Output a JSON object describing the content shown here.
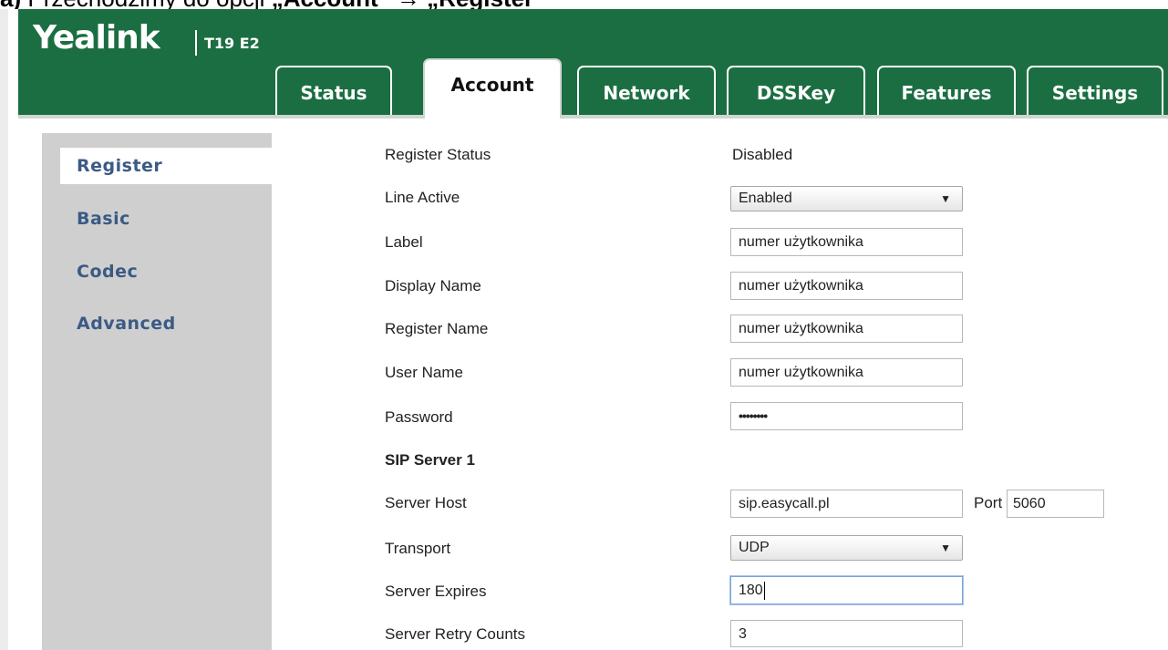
{
  "document_caption": {
    "prefix": "a)",
    "text": " Przechodzimy do opcji ",
    "item1": "„Account”",
    "joiner": " → ",
    "item2": "„Register”"
  },
  "app": {
    "brand": "Yealink",
    "model": "T19 E2"
  },
  "tabs": [
    {
      "label": "Status",
      "active": false
    },
    {
      "label": "Account",
      "active": true
    },
    {
      "label": "Network",
      "active": false
    },
    {
      "label": "DSSKey",
      "active": false
    },
    {
      "label": "Features",
      "active": false
    },
    {
      "label": "Settings",
      "active": false
    }
  ],
  "sidebar": {
    "items": [
      {
        "label": "Register",
        "active": true
      },
      {
        "label": "Basic",
        "active": false
      },
      {
        "label": "Codec",
        "active": false
      },
      {
        "label": "Advanced",
        "active": false
      }
    ]
  },
  "form": {
    "register_status": {
      "label": "Register Status",
      "value": "Disabled"
    },
    "line_active": {
      "label": "Line Active",
      "value": "Enabled"
    },
    "label": {
      "label": "Label",
      "value": "numer użytkownika"
    },
    "display_name": {
      "label": "Display Name",
      "value": "numer użytkownika"
    },
    "register_name": {
      "label": "Register Name",
      "value": "numer użytkownika"
    },
    "user_name": {
      "label": "User Name",
      "value": "numer użytkownika"
    },
    "password": {
      "label": "Password",
      "value": "••••••••"
    },
    "sip_server_title": "SIP Server 1",
    "server_host": {
      "label": "Server Host",
      "value": "sip.easycall.pl"
    },
    "port": {
      "label": "Port",
      "value": "5060"
    },
    "transport": {
      "label": "Transport",
      "value": "UDP"
    },
    "server_expires": {
      "label": "Server Expires",
      "value": "180"
    },
    "server_retry_counts": {
      "label": "Server Retry Counts",
      "value": "3"
    }
  },
  "colors": {
    "header_green": "#1b6e41",
    "sidebar_gray": "#cfcfcf",
    "sidebar_text": "#3b5a85"
  }
}
